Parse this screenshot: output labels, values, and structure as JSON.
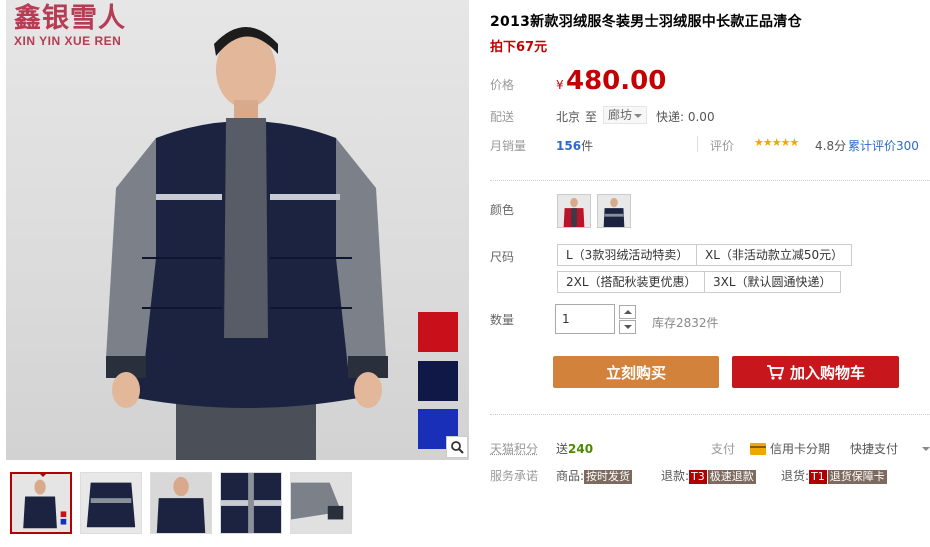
{
  "brand": {
    "name_cn": "鑫银雪人",
    "name_en": "XIN YIN XUE REN"
  },
  "product": {
    "title": "2013新款羽绒服冬装男士羽绒服中长款正品清仓",
    "promo": "拍下67元"
  },
  "price": {
    "label": "价格",
    "currency": "¥",
    "value": "480.00"
  },
  "shipping": {
    "label": "配送",
    "from": "北京",
    "to_word": "至",
    "destination": "廊坊",
    "express": "快递: 0.00"
  },
  "sales": {
    "label": "月销量",
    "count": "156",
    "unit": "件"
  },
  "rating": {
    "label": "评价",
    "stars": "★★★★★",
    "score": "4.8分",
    "reviews": "累计评价300"
  },
  "color": {
    "label": "颜色"
  },
  "size": {
    "label": "尺码",
    "options": [
      "L（3款羽绒活动特卖）",
      "XL（非活动款立减50元）",
      "2XL（搭配秋装更优惠）",
      "3XL（默认圆通快递）"
    ]
  },
  "quantity": {
    "label": "数量",
    "value": "1",
    "stock": "库存2832件"
  },
  "buttons": {
    "buy": "立刻购买",
    "cart": "加入购物车"
  },
  "points": {
    "label": "天猫积分",
    "value_prefix": "送",
    "value": "240"
  },
  "payment": {
    "label": "支付",
    "credit": "信用卡分期",
    "quick": "快捷支付"
  },
  "service": {
    "label": "服务承诺",
    "goods_label": "商品:",
    "goods_tag": "按时发货",
    "refund_label": "退款:",
    "refund_code": "T3",
    "refund_tag": "极速退款",
    "return_label": "退货:",
    "return_code": "T1",
    "return_tag": "退货保障卡"
  },
  "colors": {
    "price_red": "#c40000",
    "buy_button": "#d2823a",
    "cart_button": "#c8161d",
    "swatch_red": "#c8101a",
    "swatch_navy": "#101848",
    "swatch_blue": "#1a2fb8"
  }
}
